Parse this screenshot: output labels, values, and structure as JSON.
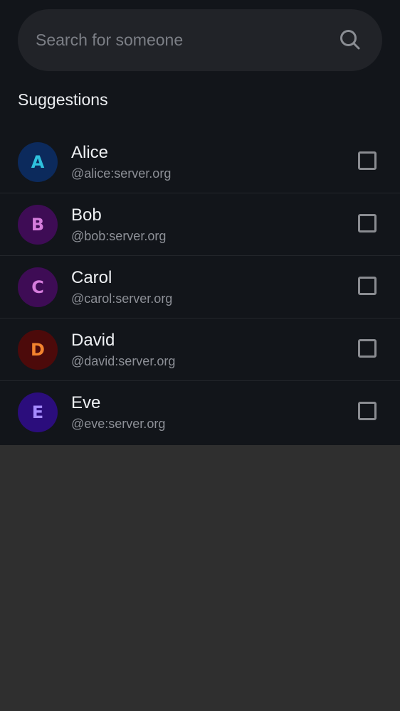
{
  "search": {
    "placeholder": "Search for someone",
    "value": "",
    "icon": "search-icon"
  },
  "suggestions": {
    "title": "Suggestions",
    "items": [
      {
        "initial": "A",
        "name": "Alice",
        "handle": "@alice:server.org",
        "avatar_bg": "#0c2a5c",
        "avatar_fg": "#2fc1dd",
        "checked": false
      },
      {
        "initial": "B",
        "name": "Bob",
        "handle": "@bob:server.org",
        "avatar_bg": "#3e0c55",
        "avatar_fg": "#d57ddc",
        "checked": false
      },
      {
        "initial": "C",
        "name": "Carol",
        "handle": "@carol:server.org",
        "avatar_bg": "#3e0c55",
        "avatar_fg": "#d57ddc",
        "checked": false
      },
      {
        "initial": "D",
        "name": "David",
        "handle": "@david:server.org",
        "avatar_bg": "#4c0a0a",
        "avatar_fg": "#f3832e",
        "checked": false
      },
      {
        "initial": "E",
        "name": "Eve",
        "handle": "@eve:server.org",
        "avatar_bg": "#2b0d7c",
        "avatar_fg": "#a58bff",
        "checked": false
      }
    ]
  },
  "colors": {
    "panel_background": "#12151a",
    "page_background": "#2f2f2f",
    "search_background": "#212328",
    "divider": "#23262b"
  }
}
